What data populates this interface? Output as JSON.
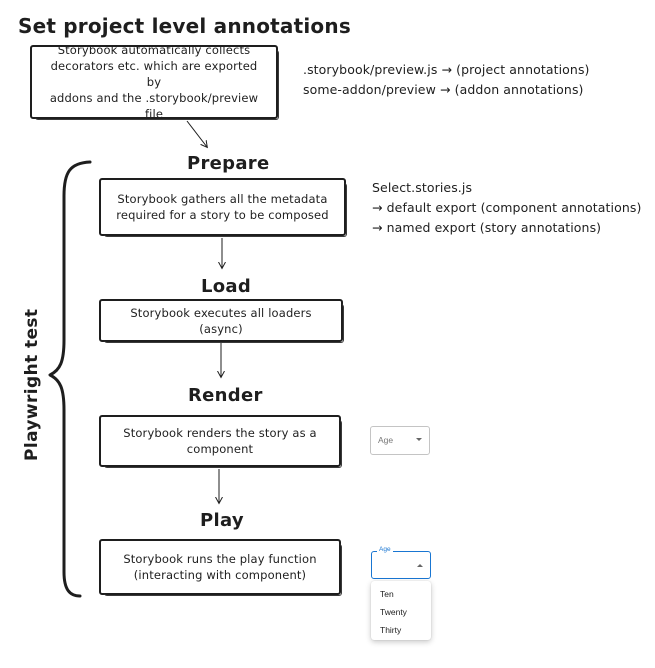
{
  "title": "Set project level annotations",
  "project_box": {
    "text": "Storybook automatically collects\ndecorators etc. which are exported by\naddons and the .storybook/preview file"
  },
  "project_notes": [
    ".storybook/preview.js → (project annotations)",
    "some-addon/preview → (addon annotations)"
  ],
  "steps": [
    {
      "title": "Prepare",
      "box": "Storybook gathers all the metadata\nrequired for a story to be composed"
    },
    {
      "title": "Load",
      "box": "Storybook executes all loaders (async)"
    },
    {
      "title": "Render",
      "box": "Storybook renders the story as a\ncomponent"
    },
    {
      "title": "Play",
      "box": "Storybook runs the play function\n(interacting with component)"
    }
  ],
  "prepare_notes": [
    "Select.stories.js",
    "→ default export (component annotations)",
    "→ named export (story annotations)"
  ],
  "bracket_label": "Playwright test",
  "render_select": {
    "label": "Age",
    "icon": "chevron-down-icon"
  },
  "play_select": {
    "label": "Age",
    "icon": "chevron-up-icon",
    "options": [
      "Ten",
      "Twenty",
      "Thirty"
    ],
    "accent": "#1976d2"
  },
  "colors": {
    "ink": "#1e1e1e",
    "background": "#ffffff"
  }
}
